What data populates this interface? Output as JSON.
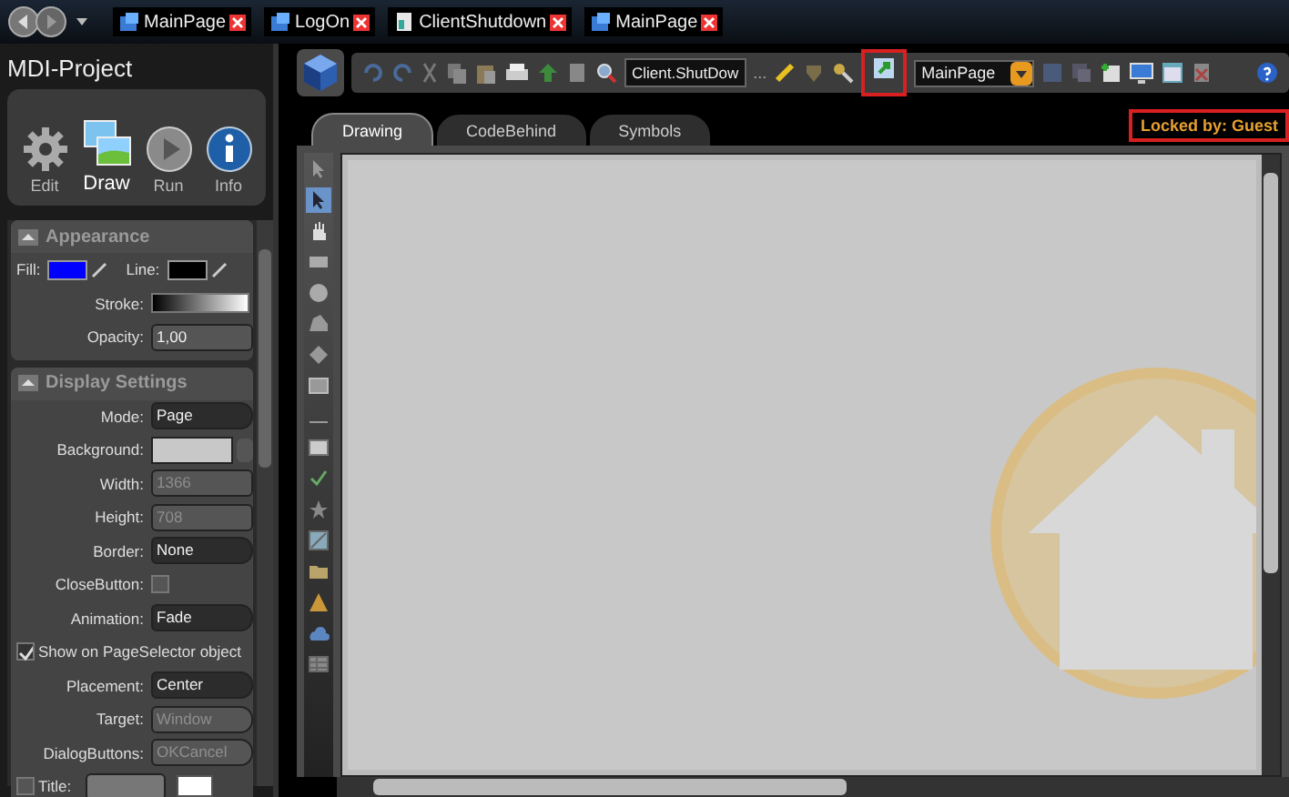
{
  "doc_tabs": [
    {
      "label": "MainPage",
      "kind": "page"
    },
    {
      "label": "LogOn",
      "kind": "page"
    },
    {
      "label": "ClientShutdown",
      "kind": "script"
    },
    {
      "label": "MainPage",
      "kind": "page"
    }
  ],
  "project": {
    "title": "MDI-Project",
    "ribbon": [
      {
        "label": "Edit",
        "kind": "gear",
        "selected": false
      },
      {
        "label": "Draw",
        "kind": "pictures",
        "selected": true
      },
      {
        "label": "Run",
        "kind": "play",
        "selected": false
      },
      {
        "label": "Info",
        "kind": "info",
        "selected": false
      }
    ]
  },
  "appearance": {
    "title": "Appearance",
    "fill": {
      "label": "Fill:",
      "color": "#0000ff"
    },
    "line": {
      "label": "Line:",
      "color": "#000000"
    },
    "stroke": {
      "label": "Stroke:"
    },
    "opacity": {
      "label": "Opacity:",
      "value": "1,00"
    }
  },
  "display_settings": {
    "title": "Display Settings",
    "rows": [
      {
        "kind": "dropdown",
        "label": "Mode:",
        "value": "Page",
        "disabled": false
      },
      {
        "kind": "swatch",
        "label": "Background:",
        "color": "#c8c8c8"
      },
      {
        "kind": "field",
        "label": "Width:",
        "value": "1366",
        "disabled": true
      },
      {
        "kind": "field",
        "label": "Height:",
        "value": "708",
        "disabled": true
      },
      {
        "kind": "dropdown",
        "label": "Border:",
        "value": "None",
        "disabled": false
      },
      {
        "kind": "checkbox",
        "label": "CloseButton:",
        "checked": false
      },
      {
        "kind": "dropdown",
        "label": "Animation:",
        "value": "Fade",
        "disabled": false
      },
      {
        "kind": "wide_checkbox",
        "label": "Show on PageSelector object",
        "checked": true
      },
      {
        "kind": "dropdown",
        "label": "Placement:",
        "value": "Center",
        "disabled": false
      },
      {
        "kind": "dropdown",
        "label": "Target:",
        "value": "Window",
        "disabled": true
      },
      {
        "kind": "dropdown",
        "label": "DialogButtons:",
        "value": "OKCancel",
        "disabled": true
      },
      {
        "kind": "title",
        "label": "Title:",
        "checked": false,
        "color": "#ffffff"
      }
    ]
  },
  "toolbar": {
    "document": "Client.ShutDow",
    "more": "...",
    "page": "MainPage",
    "highlighted_button": true
  },
  "editor_tabs": [
    {
      "label": "Drawing",
      "selected": true
    },
    {
      "label": "CodeBehind",
      "selected": false
    },
    {
      "label": "Symbols",
      "selected": false
    }
  ],
  "lock": {
    "label": "Locked by: Guest",
    "highlighted": true
  },
  "tools": [
    {
      "kind": "pointer",
      "selected": false
    },
    {
      "kind": "pointer",
      "selected": true
    },
    {
      "kind": "hand",
      "selected": false
    },
    {
      "kind": "rect",
      "selected": false
    },
    {
      "kind": "ellipse",
      "selected": false
    },
    {
      "kind": "polygon",
      "selected": false
    },
    {
      "kind": "node",
      "selected": false
    },
    {
      "kind": "button",
      "selected": false
    },
    {
      "kind": "label",
      "selected": false
    },
    {
      "kind": "textbox",
      "selected": false
    },
    {
      "kind": "check",
      "selected": false
    },
    {
      "kind": "star",
      "selected": false
    },
    {
      "kind": "picture",
      "selected": false
    },
    {
      "kind": "folder",
      "selected": false
    },
    {
      "kind": "warning",
      "selected": false
    },
    {
      "kind": "cloud",
      "selected": false
    },
    {
      "kind": "grid",
      "selected": false
    }
  ]
}
